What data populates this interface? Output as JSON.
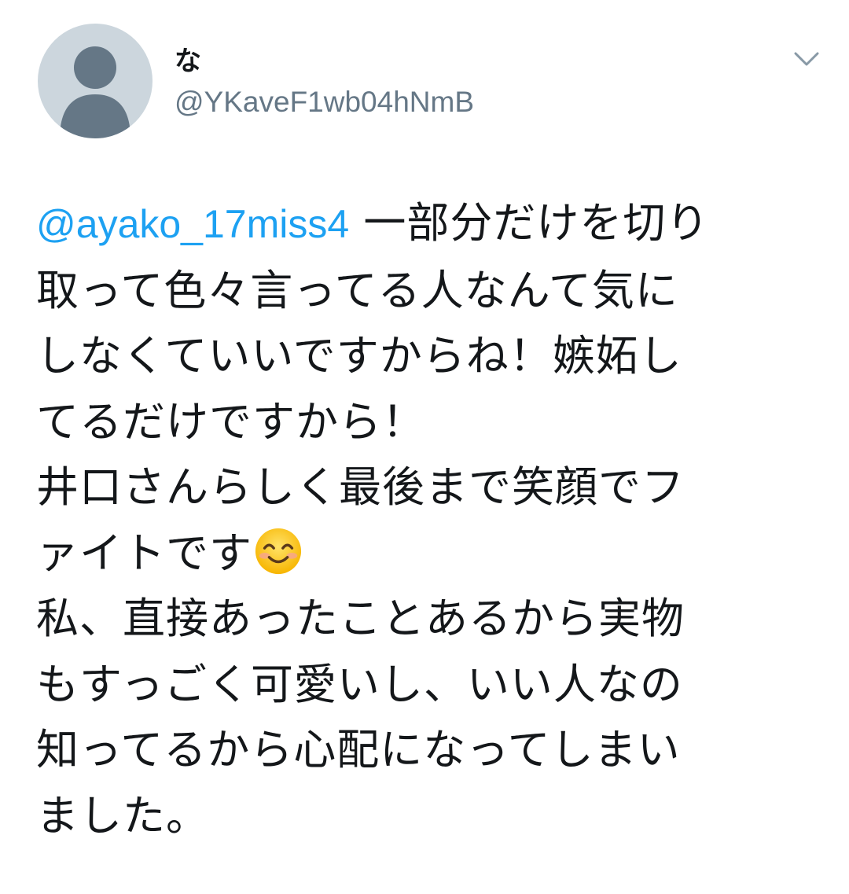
{
  "tweet": {
    "display_name": "な",
    "handle": "@YKaveF1wb04hNmB",
    "avatar_icon": "default-profile-silhouette-icon",
    "menu_icon": "chevron-down-icon",
    "mention": "@ayako_17miss4",
    "lines": [
      "一部分だけを切り",
      "取って色々言ってる人なんて気に",
      "しなくていいですからね！嫉妬し",
      "てるだけですから！",
      "井口さんらしく最後まで笑顔でフ",
      "ァイトです",
      "私、直接あったことあるから実物",
      "もすっごく可愛いし、いい人なの",
      "知ってるから心配になってしまい",
      "ました。"
    ],
    "emoji_icon": "smiling-face-with-smiling-eyes-icon"
  },
  "colors": {
    "mention": "#1da1f2",
    "handle": "#657786",
    "avatar_bg": "#ccd6dd",
    "avatar_figure": "#657786",
    "text": "#14171a"
  }
}
